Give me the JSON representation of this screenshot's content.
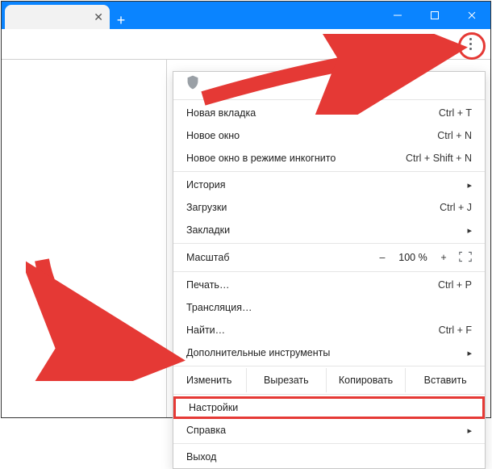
{
  "window": {
    "minimize": "–",
    "maximize": "▭",
    "close": "✕"
  },
  "tab": {
    "title": "",
    "close_glyph": "✕"
  },
  "toolbar": {
    "new_tab_glyph": "+"
  },
  "menu": {
    "new_tab": {
      "label": "Новая вкладка",
      "shortcut": "Ctrl + T"
    },
    "new_window": {
      "label": "Новое окно",
      "shortcut": "Ctrl + N"
    },
    "incognito": {
      "label": "Новое окно в режиме инкогнито",
      "shortcut": "Ctrl + Shift + N"
    },
    "history": {
      "label": "История"
    },
    "downloads": {
      "label": "Загрузки",
      "shortcut": "Ctrl + J"
    },
    "bookmarks": {
      "label": "Закладки"
    },
    "zoom": {
      "label": "Масштаб",
      "minus": "–",
      "value": "100 %",
      "plus": "+"
    },
    "print": {
      "label": "Печать…",
      "shortcut": "Ctrl + P"
    },
    "cast": {
      "label": "Трансляция…"
    },
    "find": {
      "label": "Найти…",
      "shortcut": "Ctrl + F"
    },
    "more_tools": {
      "label": "Дополнительные инструменты"
    },
    "edit": {
      "label": "Изменить",
      "cut": "Вырезать",
      "copy": "Копировать",
      "paste": "Вставить"
    },
    "settings": {
      "label": "Настройки"
    },
    "help": {
      "label": "Справка"
    },
    "exit": {
      "label": "Выход"
    }
  },
  "annotation": {
    "highlight_color": "#e53935"
  }
}
